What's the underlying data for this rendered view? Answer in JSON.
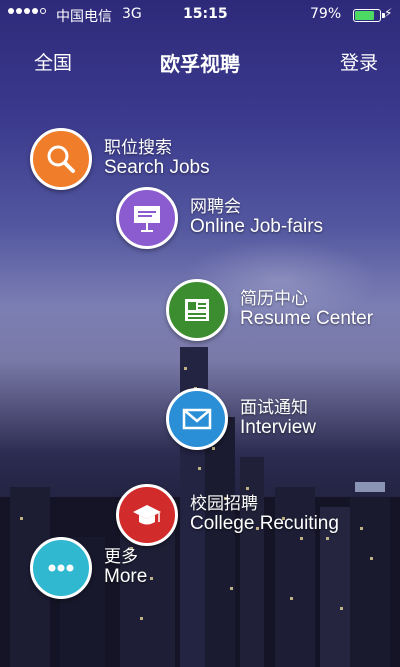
{
  "status_bar": {
    "carrier": "中国电信",
    "network": "3G",
    "time": "15:15",
    "battery_percent": "79%",
    "battery_level": 0.79
  },
  "nav": {
    "left_label": "全国",
    "title": "欧孚视聘",
    "right_label": "登录"
  },
  "menu": [
    {
      "zh": "职位搜索",
      "en": "Search Jobs",
      "color": "#f07d2a",
      "icon": "search-icon"
    },
    {
      "zh": "网聘会",
      "en": "Online Job-fairs",
      "color": "#8a5ccf",
      "icon": "presentation-icon"
    },
    {
      "zh": "简历中心",
      "en": "Resume Center",
      "color": "#3c8d2f",
      "icon": "document-icon"
    },
    {
      "zh": "面试通知",
      "en": "Interview",
      "color": "#2a8fd6",
      "icon": "envelope-icon"
    },
    {
      "zh": "校园招聘",
      "en": "College Recuiting",
      "color": "#d22b2b",
      "icon": "graduation-cap-icon"
    },
    {
      "zh": "更多",
      "en": "More",
      "color": "#2fb8d0",
      "icon": "more-icon"
    }
  ]
}
